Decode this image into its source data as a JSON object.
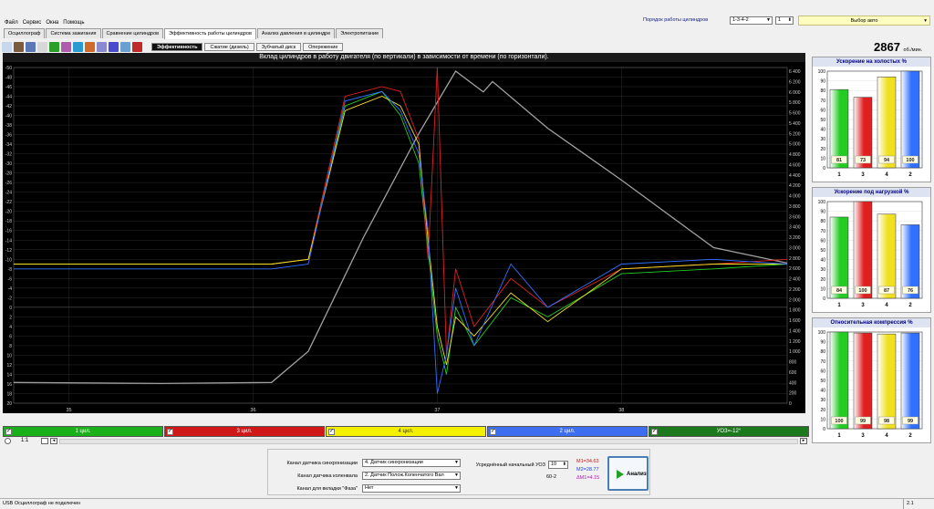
{
  "menu": [
    "Файл",
    "Сервис",
    "Окна",
    "Помощь"
  ],
  "tabs": [
    "Осциллограф",
    "Система зажигания",
    "Сравнение цилиндров",
    "Эффективность работы цилиндров",
    "Анализ давления в цилиндре",
    "Электропитание"
  ],
  "active_tab": 3,
  "firing_order": {
    "label": "Порядок работы цилиндров",
    "value": "1-3-4-2",
    "spin": "1"
  },
  "auto_select": "Выбор авто",
  "subtabs": [
    "Эффективность",
    "Сжатие (дизель)",
    "Зубчатый диск",
    "Опережение"
  ],
  "rpm": {
    "value": "2867",
    "unit": "об./мин."
  },
  "chart_data": {
    "type": "line",
    "title": "Вклад цилиндров в работу двигателя (по вертикали) в зависимости от времени (по горизонтали).",
    "x_ticks": [
      "35",
      "36",
      "37",
      "38"
    ],
    "y_left_ticks": [
      "-50",
      "-48",
      "-46",
      "-44",
      "-42",
      "-40",
      "-38",
      "-36",
      "-34",
      "-32",
      "-30",
      "-28",
      "-26",
      "-24",
      "-22",
      "-20",
      "-18",
      "-16",
      "-14",
      "-12",
      "-10",
      "-8",
      "-6",
      "-4",
      "-2",
      "0",
      "2",
      "4",
      "6",
      "8",
      "10",
      "12",
      "14",
      "16",
      "18",
      "20"
    ],
    "y_right_ticks": [
      "6 400",
      "6 200",
      "6 000",
      "5 800",
      "5 600",
      "5 400",
      "5 200",
      "5 000",
      "4 800",
      "4 600",
      "4 400",
      "4 200",
      "4 000",
      "3 800",
      "3 600",
      "3 400",
      "3 200",
      "3 000",
      "2 800",
      "2 600",
      "2 400",
      "2 200",
      "2 000",
      "1 800",
      "1 600",
      "1 400",
      "1 200",
      "1 000",
      "800",
      "600",
      "400",
      "200",
      "0"
    ],
    "xlim": [
      34.7,
      38.9
    ],
    "series": [
      {
        "name": "1 цил.",
        "color": "#22cc22",
        "x": [
          34.7,
          35.5,
          36.1,
          36.3,
          36.5,
          36.7,
          36.8,
          36.9,
          36.95,
          37.0,
          37.05,
          37.1,
          37.2,
          37.4,
          37.6,
          38.0,
          38.5,
          38.9
        ],
        "y": [
          -9,
          -9,
          -9,
          -10,
          -42,
          -45,
          -40,
          -30,
          -12,
          6,
          14,
          0,
          8,
          -2,
          2,
          -7,
          -8,
          -9
        ]
      },
      {
        "name": "3 цил.",
        "color": "#e02020",
        "x": [
          34.7,
          35.5,
          36.1,
          36.3,
          36.5,
          36.7,
          36.8,
          36.9,
          36.95,
          37.0,
          37.05,
          37.1,
          37.2,
          37.4,
          37.6,
          38.0,
          38.5,
          38.9
        ],
        "y": [
          -9,
          -9,
          -9,
          -10,
          -44,
          -46,
          -45,
          -35,
          -10,
          -50,
          10,
          -8,
          4,
          -6,
          0,
          -8,
          -9,
          -10
        ]
      },
      {
        "name": "4 цил.",
        "color": "#f0e020",
        "x": [
          34.7,
          35.5,
          36.1,
          36.3,
          36.5,
          36.7,
          36.8,
          36.9,
          36.95,
          37.0,
          37.05,
          37.1,
          37.2,
          37.4,
          37.6,
          38.0,
          38.5,
          38.9
        ],
        "y": [
          -9,
          -9,
          -9,
          -10,
          -41,
          -44,
          -42,
          -34,
          -14,
          4,
          12,
          2,
          6,
          -3,
          3,
          -8,
          -9,
          -9
        ]
      },
      {
        "name": "2 цил.",
        "color": "#3070ff",
        "x": [
          34.7,
          35.5,
          36.1,
          36.3,
          36.5,
          36.7,
          36.8,
          36.9,
          36.95,
          37.0,
          37.05,
          37.1,
          37.2,
          37.4,
          37.6,
          38.0,
          38.5,
          38.9
        ],
        "y": [
          -8,
          -8,
          -8,
          -9,
          -43,
          -45,
          -41,
          -32,
          -16,
          18,
          10,
          -4,
          8,
          -9,
          0,
          -9,
          -10,
          -9
        ]
      }
    ],
    "rpm_series": {
      "name": "УОЗ=-12°",
      "color": "#a0a0a0",
      "x": [
        34.7,
        35.5,
        36.1,
        36.3,
        36.6,
        36.9,
        37.1,
        37.25,
        37.3,
        37.6,
        38.0,
        38.5,
        38.9
      ],
      "rpm": [
        400,
        380,
        400,
        1000,
        3200,
        5200,
        6400,
        6000,
        6200,
        5300,
        4300,
        3000,
        2700
      ]
    }
  },
  "channels": [
    {
      "label": "1 цил.",
      "color": "#19b019"
    },
    {
      "label": "3 цил.",
      "color": "#d01818"
    },
    {
      "label": "4 цил.",
      "color": "#f4f000"
    },
    {
      "label": "2 цил.",
      "color": "#3d6ef0"
    },
    {
      "label": "УОЗ=-12°",
      "color": "#1c7a1c"
    }
  ],
  "zoom_value": "1:1",
  "panels": [
    {
      "title": "Ускорение на холостых %",
      "values": [
        81,
        73,
        94,
        100
      ],
      "labels": [
        "1",
        "3",
        "4",
        "2"
      ]
    },
    {
      "title": "Ускорение под нагрузкой %",
      "values": [
        84,
        100,
        87,
        76
      ],
      "labels": [
        "1",
        "3",
        "4",
        "2"
      ]
    },
    {
      "title": "Относительная компрессия %",
      "values": [
        100,
        99,
        98,
        99
      ],
      "labels": [
        "1",
        "3",
        "4",
        "2"
      ]
    }
  ],
  "panel_y_ticks": [
    "100",
    "90",
    "80",
    "70",
    "60",
    "50",
    "40",
    "30",
    "20",
    "10",
    "0"
  ],
  "bar_colors": [
    "#22cc22",
    "#e02020",
    "#f0e020",
    "#3070ff"
  ],
  "bottom": {
    "sync_label": "Канал датчика синхронизации",
    "sync_value": "4. Датчик синхронизации",
    "crank_label": "Канал датчика коленвала",
    "crank_value": "2. Датчик Полож.Коленчатого Вал",
    "phase_label": "Канал для вкладки \"Фаза\"",
    "phase_value": "Нет",
    "uoz_label": "Усреднённый начальный УОЗ",
    "uoz_value": "10",
    "teeth": "60-2",
    "m1": "M1=34.63",
    "m2": "M2=28.77",
    "dm": "ΔM1=4.15",
    "analysis": "Анализ"
  },
  "status": {
    "left": "USB Осциллограф не подключен",
    "right": "2.1"
  }
}
